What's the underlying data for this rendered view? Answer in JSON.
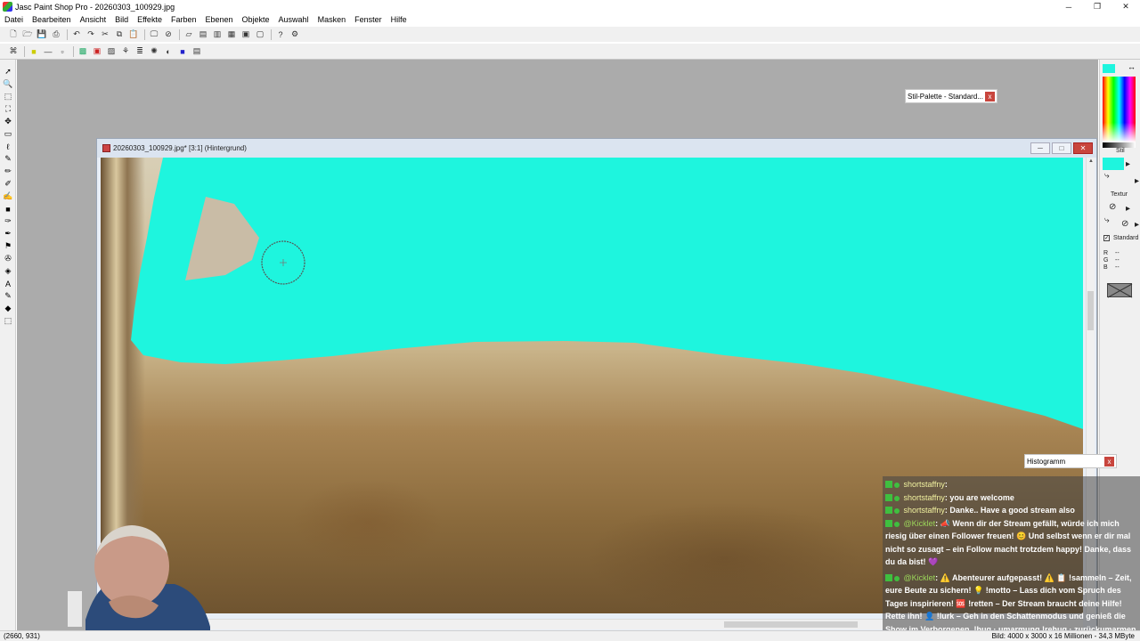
{
  "window": {
    "title": "Jasc Paint Shop Pro - 20260303_100929.jpg",
    "controls": [
      "─",
      "❐",
      "✕"
    ]
  },
  "menu": [
    "Datei",
    "Bearbeiten",
    "Ansicht",
    "Bild",
    "Effekte",
    "Farben",
    "Ebenen",
    "Objekte",
    "Auswahl",
    "Masken",
    "Fenster",
    "Hilfe"
  ],
  "toolbar1_icons": [
    "new-icon",
    "open-icon",
    "save-icon",
    "print-icon",
    "undo-icon",
    "redo-icon",
    "cut-icon",
    "copy-icon",
    "paste-icon",
    "browse-icon",
    "help-icon",
    "full-screen-icon",
    "toggle-grid-icon",
    "histogram-icon",
    "layer-palette-icon",
    "overview-icon",
    "tool-options-icon",
    "whats-this-icon",
    "script-icon"
  ],
  "toolbar2_icons": [
    "script-run-icon",
    "foreground-icon",
    "selection-icon",
    "float-icon",
    "effects-icon",
    "color-icon",
    "layers-icon",
    "tube-icon",
    "filter-icon",
    "brush-icon",
    "paint-icon",
    "palette-icon",
    "stripes-icon"
  ],
  "left_tools": [
    "arrow-tool-icon",
    "zoom-tool-icon",
    "deform-tool-icon",
    "crop-tool-icon",
    "move-tool-icon",
    "selection-tool-icon",
    "lasso-tool-icon",
    "dropper-tool-icon",
    "paintbrush-tool-icon",
    "clone-brush-icon",
    "color-replacer-icon",
    "retouch-tool-icon",
    "scratch-remover-icon",
    "eraser-tool-icon",
    "picture-tube-icon",
    "airbrush-tool-icon",
    "flood-fill-icon",
    "text-tool-icon",
    "draw-tool-icon",
    "preset-shapes-icon",
    "object-selector-icon"
  ],
  "right_panel": {
    "stil_label": "Stil",
    "textur_label": "Textur",
    "standard_label": "Standard",
    "rgb_labels": [
      "R",
      "G",
      "B"
    ],
    "rgb_values": [
      "--",
      "--",
      "--"
    ],
    "foreground_color": "#1ef5de"
  },
  "stil_palette": {
    "title": "Stil-Palette - Standard...",
    "close": "x"
  },
  "histogram": {
    "title": "Histogramm",
    "close": "x"
  },
  "document": {
    "title": "20260303_100929.jpg* [3:1] (Hintergrund)",
    "controls": [
      "─",
      "□",
      "✕"
    ],
    "fill_color": "#1ef5de"
  },
  "chat": [
    {
      "user": "shortstaffny",
      "msg": ": ",
      "kick": false
    },
    {
      "user": "shortstaffny",
      "msg": ": you are welcome",
      "kick": false
    },
    {
      "user": "shortstaffny",
      "msg": ": Danke.. Have a good stream also",
      "kick": false
    },
    {
      "user": "@Kicklet",
      "msg": ": 📣 Wenn dir der Stream gefällt, würde ich mich riesig über einen Follower freuen! 😊 Und selbst wenn er dir mal nicht so zusagt – ein Follow macht trotzdem happy! Danke, dass du da bist! 💜",
      "kick": true
    },
    {
      "user": "@Kicklet",
      "msg": ": ⚠️ Abenteurer aufgepasst! ⚠️ 📋 !sammeln – Zeit, eure Beute zu sichern! 💡 !motto – Lass dich vom Spruch des Tages inspirieren! 🆘 !retten – Der Stream braucht deine Hilfe! Rette ihn! 👤 !lurk – Geh in den Schattenmodus und genieß die Show im Verborgenen. !hug · umarmung !rehug · zurückumarmen !ehre · muss man wohl nichts schreiben dazu 🐱",
      "kick": true
    }
  ],
  "status": {
    "coords": "(2660, 931)",
    "info": "Bild: 4000 x 3000 x 16 Millionen - 34,3 MByte"
  }
}
